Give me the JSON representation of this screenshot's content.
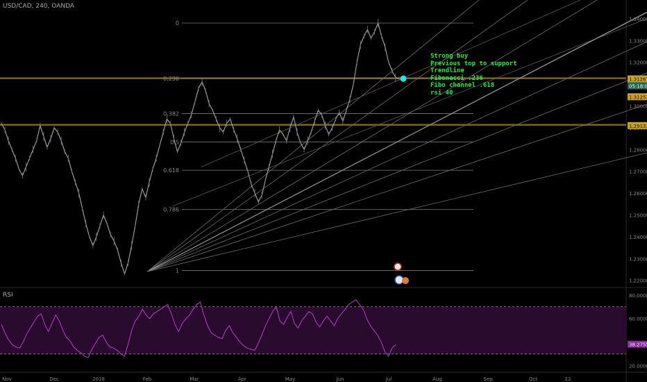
{
  "header": {
    "symbol": "USD/CAD, 240, OANDA"
  },
  "note": {
    "lines": [
      "Strong buy",
      "Previous top to support",
      "Trendline",
      "Fibonacci .236",
      "Fibo channel .618",
      "rsi 40"
    ]
  },
  "rsi_panel": {
    "label": "RSI"
  },
  "colors": {
    "background": "#000000",
    "price": "#a8a8a8",
    "fib": "#7a7a7a",
    "level": "#8a6d1f",
    "note": "#22ee44",
    "marker": "#22e6ee",
    "rsi_line": "#b440c8",
    "rsi_band": "#2a0a2e"
  },
  "chart_data": [
    {
      "type": "line",
      "title": "",
      "series": [
        {
          "name": "USD/CAD",
          "values": [
            1.292,
            1.289,
            1.284,
            1.28,
            1.276,
            1.271,
            1.268,
            1.272,
            1.276,
            1.28,
            1.284,
            1.291,
            1.286,
            1.281,
            1.285,
            1.29,
            1.288,
            1.284,
            1.279,
            1.276,
            1.27,
            1.265,
            1.26,
            1.253,
            1.246,
            1.24,
            1.236,
            1.24,
            1.245,
            1.25,
            1.246,
            1.241,
            1.238,
            1.234,
            1.228,
            1.223,
            1.228,
            1.236,
            1.245,
            1.255,
            1.262,
            1.258,
            1.265,
            1.271,
            1.276,
            1.282,
            1.288,
            1.294,
            1.292,
            1.285,
            1.279,
            1.283,
            1.288,
            1.292,
            1.296,
            1.302,
            1.308,
            1.311,
            1.307,
            1.301,
            1.298,
            1.294,
            1.29,
            1.288,
            1.292,
            1.294,
            1.289,
            1.285,
            1.28,
            1.275,
            1.27,
            1.264,
            1.26,
            1.256,
            1.259,
            1.266,
            1.272,
            1.278,
            1.284,
            1.289,
            1.287,
            1.284,
            1.29,
            1.295,
            1.288,
            1.283,
            1.28,
            1.284,
            1.288,
            1.293,
            1.298,
            1.296,
            1.291,
            1.287,
            1.29,
            1.294,
            1.297,
            1.293,
            1.298,
            1.303,
            1.31,
            1.32,
            1.328,
            1.332,
            1.335,
            1.331,
            1.334,
            1.338,
            1.332,
            1.327,
            1.32,
            1.316,
            1.313,
            1.3125
          ]
        }
      ],
      "price_labels": [
        "1.34000",
        "1.33000",
        "1.32000",
        "1.31267",
        "1.31000",
        "1.31253",
        "1.30000",
        "1.29133",
        "1.29000",
        "1.28000",
        "1.27000",
        "1.26000",
        "1.25000",
        "1.24000",
        "1.23000",
        "1.22000"
      ],
      "price_tags": [
        {
          "text": "1.31267",
          "color": "#c9a227"
        },
        {
          "text": "05:18:01",
          "color": "#1f6b5a"
        },
        {
          "text": "1.31253",
          "color": "#c9a227"
        },
        {
          "text": "1.29133",
          "color": "#c9a227"
        }
      ],
      "time_labels": [
        "Nov",
        "Dec",
        "2018",
        "Feb",
        "Mar",
        "Apr",
        "May",
        "Jun",
        "Jul",
        "Aug",
        "Sep",
        "Oct",
        "22"
      ],
      "fib_levels": [
        {
          "label": "0",
          "price": 1.338
        },
        {
          "label": "0.236",
          "price": 1.3125
        },
        {
          "label": "0.382",
          "price": 1.2965
        },
        {
          "label": "0.5",
          "price": 1.2835
        },
        {
          "label": "0.618",
          "price": 1.2705
        },
        {
          "label": "0.786",
          "price": 1.2525
        },
        {
          "label": "1",
          "price": 1.2245
        }
      ],
      "horizontal_levels": [
        1.3127,
        1.2913
      ],
      "ylim": [
        1.218,
        1.346
      ]
    },
    {
      "type": "line",
      "title": "",
      "series": [
        {
          "name": "RSI",
          "values": [
            55,
            48,
            42,
            38,
            36,
            35,
            40,
            47,
            52,
            57,
            62,
            64,
            55,
            49,
            56,
            63,
            58,
            50,
            44,
            41,
            36,
            33,
            31,
            28,
            27,
            34,
            39,
            44,
            46,
            40,
            36,
            35,
            33,
            30,
            28,
            38,
            50,
            58,
            62,
            68,
            63,
            60,
            64,
            66,
            68,
            70,
            72,
            64,
            55,
            49,
            56,
            60,
            63,
            68,
            72,
            74,
            63,
            54,
            48,
            46,
            44,
            43,
            50,
            54,
            48,
            44,
            40,
            37,
            35,
            34,
            33,
            39,
            46,
            54,
            60,
            66,
            70,
            58,
            55,
            61,
            66,
            56,
            52,
            58,
            62,
            66,
            64,
            57,
            53,
            58,
            62,
            58,
            54,
            60,
            64,
            68,
            72,
            74,
            76,
            72,
            68,
            60,
            54,
            50,
            46,
            40,
            32,
            28,
            35,
            38
          ]
        }
      ],
      "y_labels": [
        "80.0000",
        "60.0000",
        "38.2755",
        "20.0000"
      ],
      "upper_band": 70,
      "lower_band": 30,
      "current_value": "38.2755",
      "ylim": [
        18,
        84
      ]
    }
  ]
}
